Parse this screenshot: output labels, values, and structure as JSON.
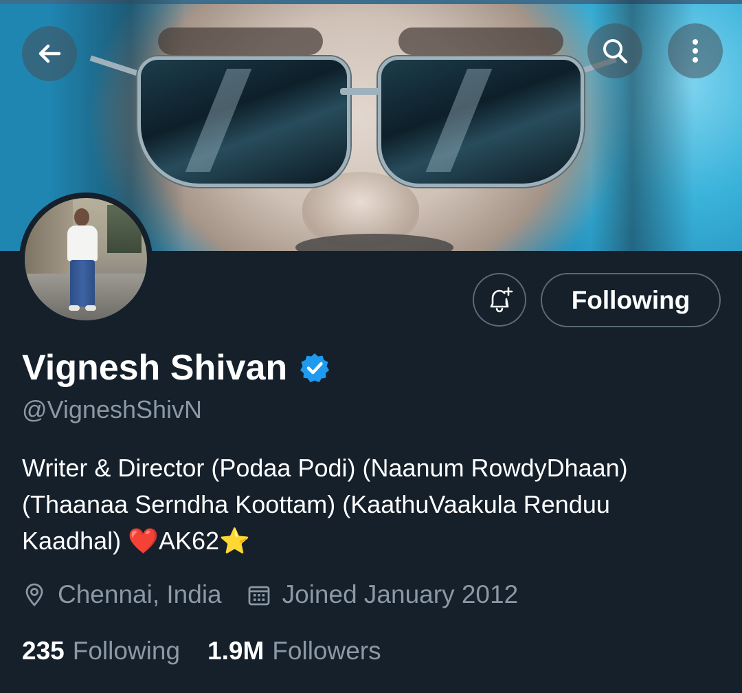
{
  "header": {
    "back_icon": "arrow-left-icon",
    "search_icon": "search-icon",
    "more_icon": "more-vertical-icon"
  },
  "profile": {
    "name": "Vignesh Shivan",
    "verified_icon": "verified-badge-icon",
    "verified_color": "#1d9bf0",
    "handle": "@VigneshShivN",
    "bio_line1": "Writer & Director (Podaa Podi) (Naanum RowdyDhaan)",
    "bio_line2": "(Thaanaa Serndha Koottam) (KaathuVaakula Renduu",
    "bio_line3_text": "Kaadhal) ",
    "bio_heart": "❤️",
    "bio_ak": "AK62",
    "bio_star": "⭐",
    "location": "Chennai, India",
    "joined": "Joined January 2012"
  },
  "actions": {
    "notify_icon": "bell-plus-icon",
    "following_label": "Following"
  },
  "stats": {
    "following_count": "235",
    "following_label": "Following",
    "followers_count": "1.9M",
    "followers_label": "Followers"
  },
  "theme": {
    "background": "#15202b",
    "secondary_text": "#8b98a5",
    "border": "#5b6b78"
  }
}
